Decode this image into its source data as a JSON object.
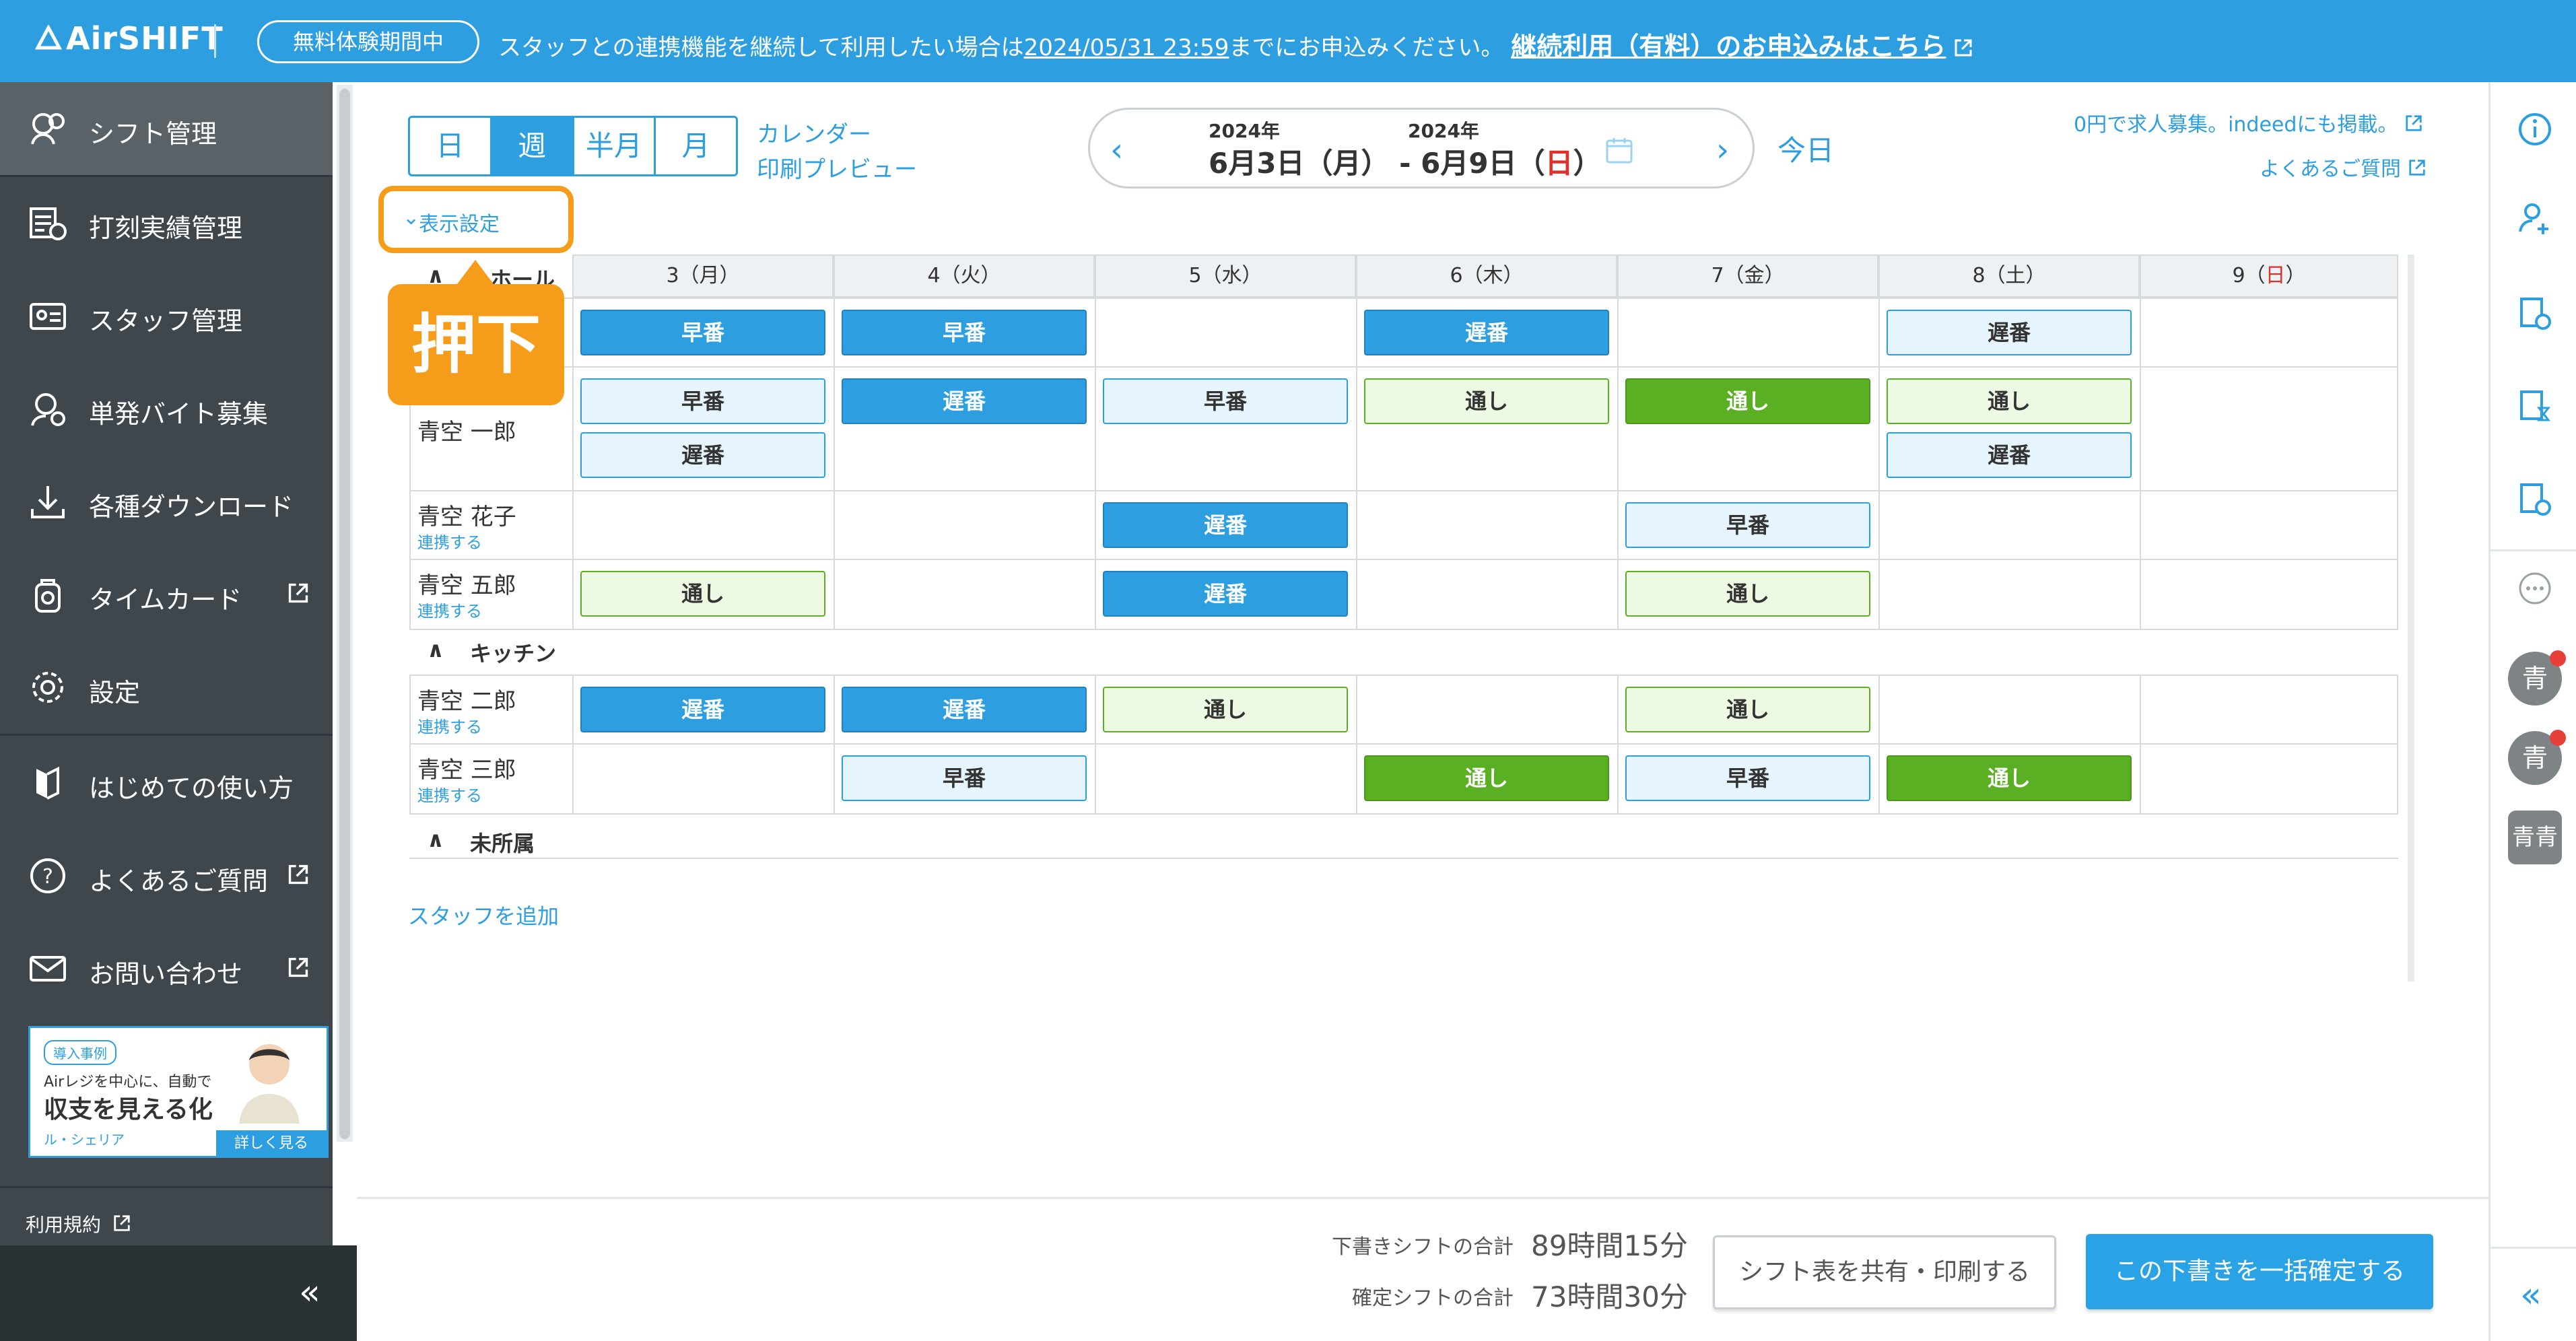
{
  "banner": {
    "logo": "AirSHIFT",
    "trial_badge": "無料体験期間中",
    "message_pre": "スタッフとの連携機能を継続して利用したい場合は",
    "deadline": "2024/05/31 23:59",
    "message_post": "までにお申込みください。",
    "cta": "継続利用（有料）のお申込みはこちら"
  },
  "sidebar": {
    "items": [
      {
        "label": "シフト管理",
        "icon": "shift-icon",
        "active": true
      },
      {
        "label": "打刻実績管理",
        "icon": "clock-record-icon"
      },
      {
        "label": "スタッフ管理",
        "icon": "staff-card-icon"
      },
      {
        "label": "単発バイト募集",
        "icon": "recruit-icon"
      },
      {
        "label": "各種ダウンロード",
        "icon": "download-icon"
      },
      {
        "label": "タイムカード",
        "icon": "timecard-icon",
        "external": true
      },
      {
        "label": "設定",
        "icon": "gear-icon"
      },
      {
        "label": "はじめての使い方",
        "icon": "guide-icon"
      },
      {
        "label": "よくあるご質問",
        "icon": "question-icon",
        "external": true
      },
      {
        "label": "お問い合わせ",
        "icon": "mail-icon",
        "external": true
      }
    ],
    "promo": {
      "tag": "導入事例",
      "line1": "Airレジを中心に、自動で",
      "headline": "収支を見える化",
      "brand": "ル・シェリア",
      "more": "詳しく見る"
    },
    "terms": "利用規約",
    "collapse": "«"
  },
  "toolbar": {
    "views": [
      "日",
      "週",
      "半月",
      "月"
    ],
    "active_view": "週",
    "calendar_link": "カレンダー",
    "print_link": "印刷プレビュー",
    "year_start": "2024年",
    "year_end": "2024年",
    "range_start": "6月3日（月）",
    "range_sep": "-",
    "range_end_pre": "6月9日（",
    "range_end_day": "日",
    "range_end_post": "）",
    "today": "今日",
    "recruit_link": "0円で求人募集。indeedにも掲載。",
    "faq_link": "よくあるご質問",
    "display_settings": "表示設定",
    "callout": "押下"
  },
  "grid": {
    "days": [
      {
        "num": "3",
        "dow": "月"
      },
      {
        "num": "4",
        "dow": "火"
      },
      {
        "num": "5",
        "dow": "水"
      },
      {
        "num": "6",
        "dow": "木"
      },
      {
        "num": "7",
        "dow": "金"
      },
      {
        "num": "8",
        "dow": "土"
      },
      {
        "num": "9",
        "dow": "日"
      }
    ],
    "groups": [
      "ホール",
      "キッチン",
      "未所属"
    ],
    "staff": [
      {
        "name": "",
        "link": ""
      },
      {
        "name": "青空 一郎",
        "link": ""
      },
      {
        "name": "青空 花子",
        "link": "連携する"
      },
      {
        "name": "青空 五郎",
        "link": "連携する"
      },
      {
        "name": "青空 二郎",
        "link": "連携する"
      },
      {
        "name": "青空 三郎",
        "link": "連携する"
      }
    ],
    "shifts": {
      "early": "早番",
      "late": "遅番",
      "full": "通し"
    },
    "add_staff": "スタッフを追加"
  },
  "footer": {
    "draft_label": "下書きシフトの合計",
    "draft_value": "89時間15分",
    "confirmed_label": "確定シフトの合計",
    "confirmed_value": "73時間30分",
    "share_button": "シフト表を共有・印刷する",
    "confirm_button": "この下書きを一括確定する"
  },
  "rail": {
    "avatars": [
      "青",
      "青"
    ],
    "square": "青青",
    "collapse": "«"
  },
  "colors": {
    "brand": "#2d9fe0",
    "sidebar": "#3f474d",
    "highlight": "#f59c1a",
    "shift_green": "#5aaf23",
    "sunday_red": "#e0302a"
  }
}
